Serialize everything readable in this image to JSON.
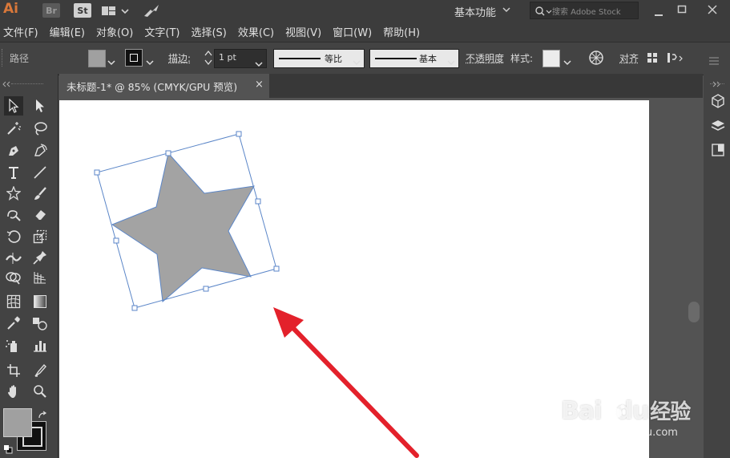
{
  "app": {
    "logo": "Ai",
    "btn_br": "Br",
    "btn_st": "St",
    "workspace": "基本功能",
    "search_placeholder": "搜索 Adobe Stock"
  },
  "menu": [
    "文件(F)",
    "编辑(E)",
    "对象(O)",
    "文字(T)",
    "选择(S)",
    "效果(C)",
    "视图(V)",
    "窗口(W)",
    "帮助(H)"
  ],
  "control": {
    "path_label": "路径",
    "stroke_label": "描边:",
    "stroke_value": "1 pt",
    "profile_label": "等比",
    "brush_label": "基本",
    "opacity_label": "不透明度",
    "style_label": "样式:",
    "align_label": "对齐",
    "fill_color": "#a0a0a0"
  },
  "tab": {
    "title": "未标题-1* @ 85% (CMYK/GPU 预览)",
    "close": "×"
  },
  "colors": {
    "star_fill": "#a3a3a3",
    "selection": "#5b86c8",
    "arrow": "#e3212b",
    "ai_orange": "#d9783a"
  },
  "watermark": {
    "brand": "Bai",
    "brand2": "du",
    "cn": "经验",
    "url": "jingyan.baidu.com"
  }
}
